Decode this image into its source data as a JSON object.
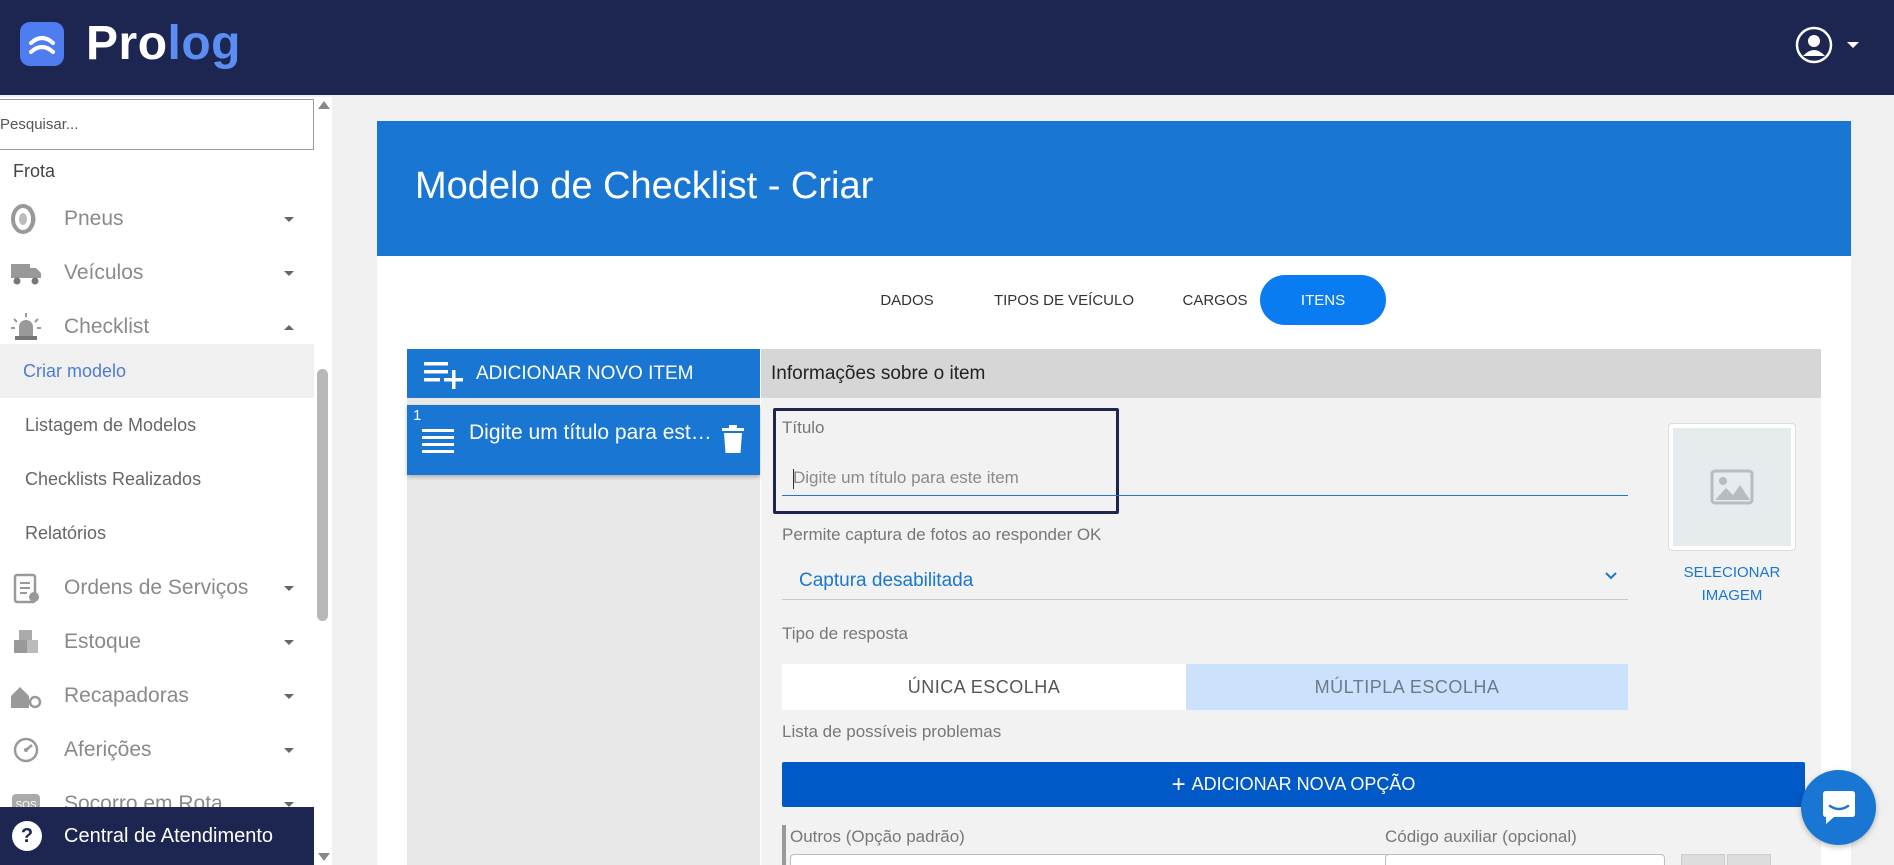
{
  "app": {
    "logo_text_a": "Pro",
    "logo_text_b": "log"
  },
  "colors": {
    "topbar": "#1c2650",
    "primary": "#1976d2",
    "tab_active": "#0a7cf1",
    "add_option": "#0059c6",
    "active_nav_text": "#4e7bd8",
    "toggle_selected": "#cce1fb"
  },
  "sidebar": {
    "search_placeholder": "Pesquisar...",
    "section": "Frota",
    "items": [
      {
        "label": "Pneus",
        "icon": "tire-icon",
        "expanded": false
      },
      {
        "label": "Veículos",
        "icon": "truck-icon",
        "expanded": false
      },
      {
        "label": "Checklist",
        "icon": "siren-icon",
        "expanded": true
      },
      {
        "label": "Ordens de Serviços",
        "icon": "clipboard-icon",
        "expanded": false
      },
      {
        "label": "Estoque",
        "icon": "boxes-icon",
        "expanded": false
      },
      {
        "label": "Recapadoras",
        "icon": "factory-icon",
        "expanded": false
      },
      {
        "label": "Aferições",
        "icon": "gauge-icon",
        "expanded": false
      },
      {
        "label": "Socorro em Rota",
        "icon": "sos-icon",
        "expanded": false
      }
    ],
    "checklist_subitems": [
      {
        "label": "Criar modelo",
        "active": true
      },
      {
        "label": "Listagem de Modelos",
        "active": false
      },
      {
        "label": "Checklists Realizados",
        "active": false
      },
      {
        "label": "Relatórios",
        "active": false
      }
    ],
    "support": {
      "label": "Central de Atendimento",
      "icon": "help-icon"
    }
  },
  "page": {
    "title": "Modelo de Checklist - Criar",
    "tabs": [
      {
        "label": "DADOS",
        "active": false
      },
      {
        "label": "TIPOS DE VEÍCULO",
        "active": false
      },
      {
        "label": "CARGOS",
        "active": false
      },
      {
        "label": "ITENS",
        "active": true
      }
    ],
    "add_item_label": "ADICIONAR NOVO ITEM",
    "item_list": [
      {
        "number": "1",
        "title": "Digite um título para este item"
      }
    ],
    "info_header": "Informações sobre o item",
    "form": {
      "title_label": "Título",
      "title_value": "",
      "title_placeholder": "Digite um título para este item",
      "photo_label": "Permite captura de fotos ao responder OK",
      "photo_value": "Captura desabilitada",
      "response_type_label": "Tipo de resposta",
      "response_types": [
        {
          "label": "ÚNICA ESCOLHA",
          "selected": false
        },
        {
          "label": "MÚLTIPLA ESCOLHA",
          "selected": true
        }
      ],
      "problems_label": "Lista de possíveis problemas",
      "add_option_label": "ADICIONAR NOVA OPÇÃO",
      "other_label": "Outros (Opção padrão)",
      "aux_code_label": "Código auxiliar (opcional)",
      "select_image_label": "SELECIONAR IMAGEM"
    }
  }
}
